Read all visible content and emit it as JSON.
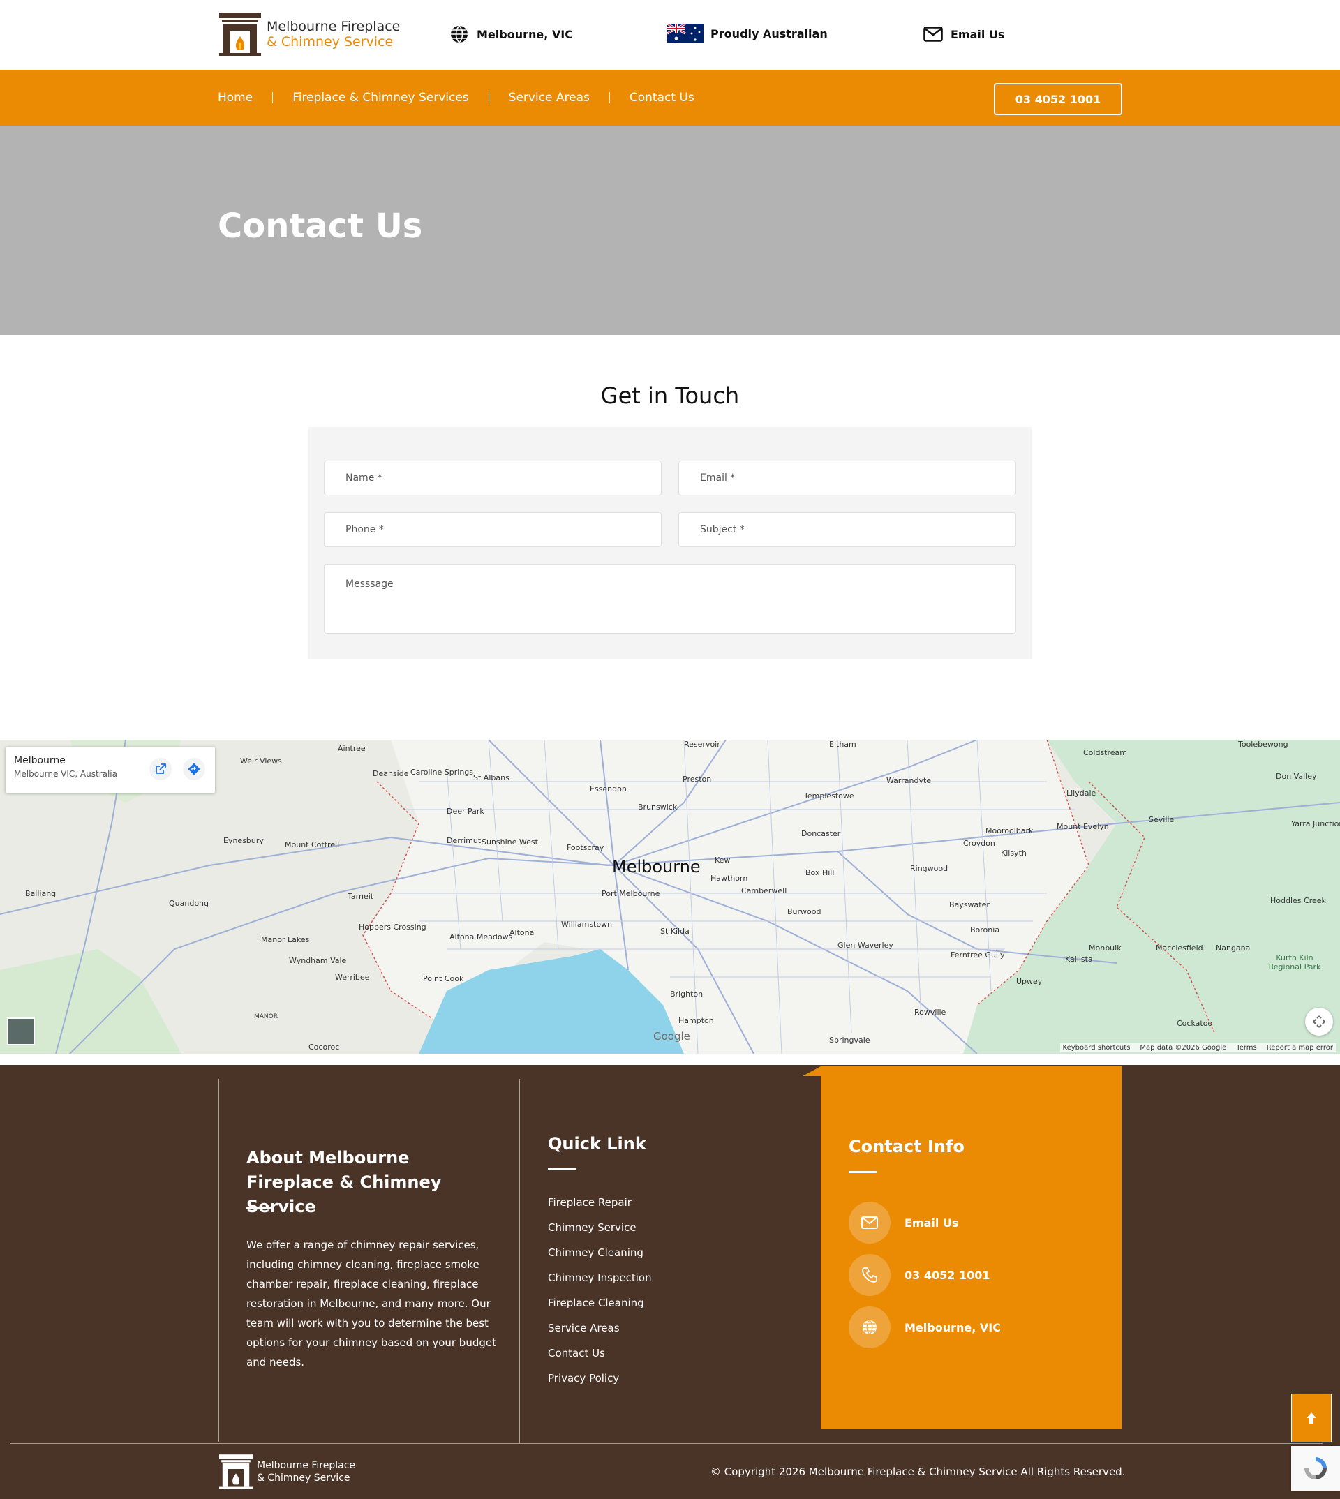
{
  "brand": {
    "name_line1": "Melbourne Fireplace",
    "name_line2": "& Chimney Service",
    "accent_color": "#ea8b03",
    "dark_color": "#4a3427"
  },
  "topbar": {
    "location": "Melbourne, VIC",
    "location_icon": "globe-icon",
    "proudly": "Proudly Australian",
    "proudly_icon": "australia-flag",
    "email": "Email Us",
    "email_icon": "mail-icon"
  },
  "nav": {
    "items": [
      {
        "label": "Home"
      },
      {
        "label": "Fireplace & Chimney Services"
      },
      {
        "label": "Service Areas"
      },
      {
        "label": "Contact Us"
      }
    ],
    "phone": "03 4052 1001"
  },
  "hero": {
    "title": "Contact Us"
  },
  "form": {
    "title": "Get in Touch",
    "name_placeholder": "Name *",
    "email_placeholder": "Email *",
    "phone_placeholder": "Phone *",
    "subject_placeholder": "Subject *",
    "message_placeholder": "Messsage"
  },
  "map": {
    "card_title": "Melbourne",
    "card_subtitle": "Melbourne VIC, Australia",
    "city_label": "Melbourne",
    "places": [
      "Aintree",
      "Weir Views",
      "Deanside",
      "Caroline Springs",
      "St Albans",
      "Essendon",
      "Preston",
      "Eltham",
      "Warrandyte",
      "Coldstream",
      "Lilydale",
      "Don Valley",
      "Eynesbury",
      "Mount Cottrell",
      "Deer Park",
      "Derrimut",
      "Sunshine West",
      "Footscray",
      "Brunswick",
      "Templestowe",
      "Doncaster",
      "Mooroolbark",
      "Croydon",
      "Kilsyth",
      "Seville",
      "Yarra Junction",
      "Balliang",
      "Quandong",
      "Tarneit",
      "Hawthorn",
      "Camberwell",
      "Kew",
      "Box Hill",
      "Ringwood",
      "Mount Evelyn",
      "Hoppers Crossing",
      "Altona Meadows",
      "Altona",
      "Williamstown",
      "Port Melbourne",
      "St Kilda",
      "Burwood",
      "Bayswater",
      "Boronia",
      "Hoddles Creek",
      "Manor Lakes",
      "Wyndham Vale",
      "Werribee",
      "Point Cook",
      "Glen Waverley",
      "Ferntree Gully",
      "Monbulk",
      "Macclesfield",
      "Nangana",
      "Kallista",
      "Kurth Kiln Regional Park",
      "Upwey",
      "Brighton",
      "Hampton",
      "Rowville",
      "Cockatoo",
      "MANOR",
      "Cocoroc",
      "Springvale",
      "Reservoir",
      "Toolebewong"
    ],
    "attribution": [
      "Keyboard shortcuts",
      "Map data ©2026 Google",
      "Terms",
      "Report a map error"
    ],
    "google": "Google"
  },
  "footer": {
    "about_title": "About Melbourne Fireplace & Chimney Service",
    "about_text": "We offer a range of chimney repair services, including chimney cleaning, fireplace smoke chamber repair, fireplace cleaning, fireplace restoration in Melbourne, and many more. Our team will work with you to determine the best options for your chimney based on your budget and needs.",
    "quick_title": "Quick Link",
    "quick_links": [
      {
        "label": "Fireplace Repair"
      },
      {
        "label": "Chimney Service"
      },
      {
        "label": "Chimney Cleaning"
      },
      {
        "label": "Chimney Inspection"
      },
      {
        "label": "Fireplace Cleaning"
      },
      {
        "label": "Service Areas"
      },
      {
        "label": "Contact Us"
      },
      {
        "label": "Privacy Policy"
      }
    ],
    "contact_title": "Contact Info",
    "contact_items": [
      {
        "icon": "mail-icon",
        "label": "Email Us"
      },
      {
        "icon": "phone-icon",
        "label": "03 4052 1001"
      },
      {
        "icon": "globe-icon",
        "label": "Melbourne, VIC"
      }
    ],
    "copyright": "© Copyright 2026 Melbourne Fireplace & Chimney Service All Rights Reserved."
  }
}
